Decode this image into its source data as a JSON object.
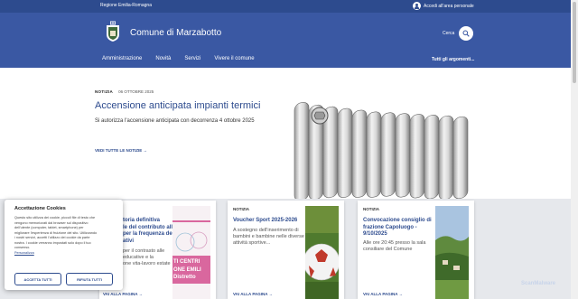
{
  "topbar": {
    "region": "Regione Emilia-Romagna",
    "login": "Accedi all'area personale"
  },
  "header": {
    "title": "Comune di Marzabotto",
    "search_label": "Cerca",
    "nav": [
      "Amministrazione",
      "Novità",
      "Servizi",
      "Vivere il comune"
    ],
    "all_topics": "Tutti gli argomenti..."
  },
  "hero": {
    "tag": "NOTIZIA",
    "date": "06 OTTOBRE 2025",
    "title": "Accensione anticipata impianti termici",
    "subtitle": "Si autorizza l'accensione anticipata con decorrenza 4 ottobre 2025",
    "all_news": "VEDI TUTTE LE NOTIZIE"
  },
  "cards": [
    {
      "title_lines": [
        "toria definitiva",
        "le del contributo alle",
        "per la frequenza dei",
        "ativi"
      ],
      "text_lines": [
        "per il contrasto alle",
        "educative e la",
        "one vita-lavoro estate"
      ],
      "more": "VAI ALLA PAGINA",
      "image_text": [
        "TI CENTRI",
        "ONE EMILI",
        "Distretto"
      ]
    },
    {
      "tag": "NOTIZIA",
      "title_lines": [
        "Voucher Sport 2025-2026"
      ],
      "text_lines": [
        "A sostegno dell'inserimento di",
        "bambini e bambine nelle diverse",
        "attività sportive..."
      ],
      "more": "VAI ALLA PAGINA"
    },
    {
      "tag": "NOTIZIA",
      "title_lines": [
        "Convocazione consiglio di",
        "frazione Capoluogo -",
        "9/10/2025"
      ],
      "text_lines": [
        "Alle ore 20:45 presso la sala",
        "consiliare del Comune"
      ],
      "more": "VAI ALLA PAGINA"
    }
  ],
  "cookie": {
    "title": "Accettazione Cookies",
    "body_lines": [
      "Questo sito utilizza dei cookie, piccoli file di testo che",
      "vengono memorizzati dal browser sul dispositivo",
      "dell'utente (computer, tablet, smartphone) per",
      "migliorare l'esperienza di fruizione del sito. Utilizzando",
      "i nostri servizi, accetti l'utilizzo dei cookie da parte",
      "nostra. I cookie verranno impostati solo dopo il tuo",
      "consenso."
    ],
    "customize": "Personalizza",
    "accept": "ACCETTA TUTTI",
    "reject": "RIFIUTA TUTTI"
  },
  "watermark": "ScanMalware",
  "icons": {
    "user": "user-icon",
    "search": "search-icon",
    "crest": "crest-icon",
    "arrow": "arrow-right-icon"
  },
  "colors": {
    "primary": "#3a58a3",
    "topbar": "#2d4b8e",
    "band": "#e6e8ec"
  }
}
